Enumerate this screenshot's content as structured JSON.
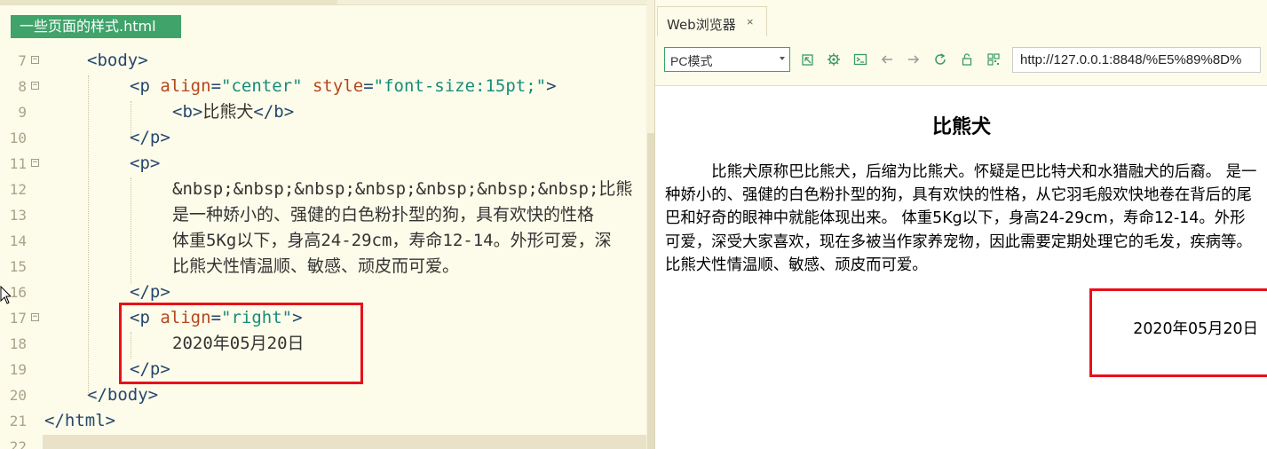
{
  "editor": {
    "file_tab": "一些页面的样式.html",
    "lines": [
      {
        "num": "7",
        "fold": "⊟",
        "indent": 2,
        "parts": [
          [
            "t",
            "<"
          ],
          [
            "tag",
            "body"
          ],
          [
            "t",
            ">"
          ]
        ]
      },
      {
        "num": "8",
        "fold": "⊟",
        "indent": 4,
        "parts": [
          [
            "t",
            "<"
          ],
          [
            "tag",
            "p"
          ],
          [
            "t",
            " "
          ],
          [
            "attr",
            "align"
          ],
          [
            "t",
            "="
          ],
          [
            "val",
            "\"center\""
          ],
          [
            "t",
            " "
          ],
          [
            "attr",
            "style"
          ],
          [
            "t",
            "="
          ],
          [
            "val",
            "\"font-size:15pt;\""
          ],
          [
            "t",
            ">"
          ]
        ]
      },
      {
        "num": "9",
        "fold": "",
        "indent": 6,
        "parts": [
          [
            "t",
            "<"
          ],
          [
            "tag",
            "b"
          ],
          [
            "t",
            ">"
          ],
          [
            "txt",
            "比熊犬"
          ],
          [
            "t",
            "</"
          ],
          [
            "tag",
            "b"
          ],
          [
            "t",
            ">"
          ]
        ]
      },
      {
        "num": "10",
        "fold": "",
        "indent": 4,
        "parts": [
          [
            "t",
            "</"
          ],
          [
            "tag",
            "p"
          ],
          [
            "t",
            ">"
          ]
        ]
      },
      {
        "num": "11",
        "fold": "⊟",
        "indent": 4,
        "parts": [
          [
            "t",
            "<"
          ],
          [
            "tag",
            "p"
          ],
          [
            "t",
            ">"
          ]
        ]
      },
      {
        "num": "12",
        "fold": "",
        "indent": 6,
        "parts": [
          [
            "txt",
            "&nbsp;&nbsp;&nbsp;&nbsp;&nbsp;&nbsp;&nbsp;比熊"
          ]
        ]
      },
      {
        "num": "13",
        "fold": "",
        "indent": 6,
        "parts": [
          [
            "txt",
            "是一种娇小的、强健的白色粉扑型的狗，具有欢快的性格"
          ]
        ]
      },
      {
        "num": "14",
        "fold": "",
        "indent": 6,
        "parts": [
          [
            "txt",
            "体重5Kg以下，身高24-29cm，寿命12-14。外形可爱，深"
          ]
        ]
      },
      {
        "num": "15",
        "fold": "",
        "indent": 6,
        "parts": [
          [
            "txt",
            "比熊犬性情温顺、敏感、顽皮而可爱。"
          ]
        ]
      },
      {
        "num": "16",
        "fold": "",
        "indent": 4,
        "parts": [
          [
            "t",
            "</"
          ],
          [
            "tag",
            "p"
          ],
          [
            "t",
            ">"
          ]
        ]
      },
      {
        "num": "17",
        "fold": "⊟",
        "indent": 4,
        "parts": [
          [
            "t",
            "<"
          ],
          [
            "tag",
            "p"
          ],
          [
            "t",
            " "
          ],
          [
            "attr",
            "align"
          ],
          [
            "t",
            "="
          ],
          [
            "val",
            "\"right\""
          ],
          [
            "t",
            ">"
          ]
        ]
      },
      {
        "num": "18",
        "fold": "",
        "indent": 6,
        "parts": [
          [
            "txt",
            "2020年05月20日"
          ]
        ]
      },
      {
        "num": "19",
        "fold": "",
        "indent": 4,
        "parts": [
          [
            "t",
            "</"
          ],
          [
            "tag",
            "p"
          ],
          [
            "t",
            ">"
          ]
        ]
      },
      {
        "num": "20",
        "fold": "",
        "indent": 2,
        "parts": [
          [
            "t",
            "</"
          ],
          [
            "tag",
            "body"
          ],
          [
            "t",
            ">"
          ]
        ]
      },
      {
        "num": "21",
        "fold": "",
        "indent": 0,
        "parts": [
          [
            "t",
            "</"
          ],
          [
            "tag",
            "html"
          ],
          [
            "t",
            ">"
          ]
        ]
      },
      {
        "num": "22",
        "fold": "",
        "indent": 0,
        "parts": []
      }
    ]
  },
  "browser": {
    "tab_label": "Web浏览器",
    "tab_close": "×",
    "mode": "PC模式",
    "toolbar_icons": [
      "open-external-icon",
      "settings-icon",
      "console-icon",
      "back-icon",
      "forward-icon",
      "refresh-icon",
      "lock-icon",
      "qr-code-icon"
    ],
    "url": "http://127.0.0.1:8848/%E5%89%8D%"
  },
  "page": {
    "title": "比熊犬",
    "body": "　　　比熊犬原称巴比熊犬，后缩为比熊犬。怀疑是巴比特犬和水猎融犬的后裔。 是一种娇小的、强健的白色粉扑型的狗，具有欢快的性格，从它羽毛般欢快地卷在背后的尾巴和好奇的眼神中就能体现出来。 体重5Kg以下，身高24-29cm，寿命12-14。外形可爱，深受大家喜欢，现在多被当作家养宠物，因此需要定期处理它的毛发，疾病等。 比熊犬性情温顺、敏感、顽皮而可爱。",
    "date": "2020年05月20日"
  },
  "colors": {
    "tab_green": "#3fa36a",
    "highlight_red": "#e8101b",
    "tag": "#25476f",
    "attr": "#b4471e",
    "value": "#178c7c"
  }
}
